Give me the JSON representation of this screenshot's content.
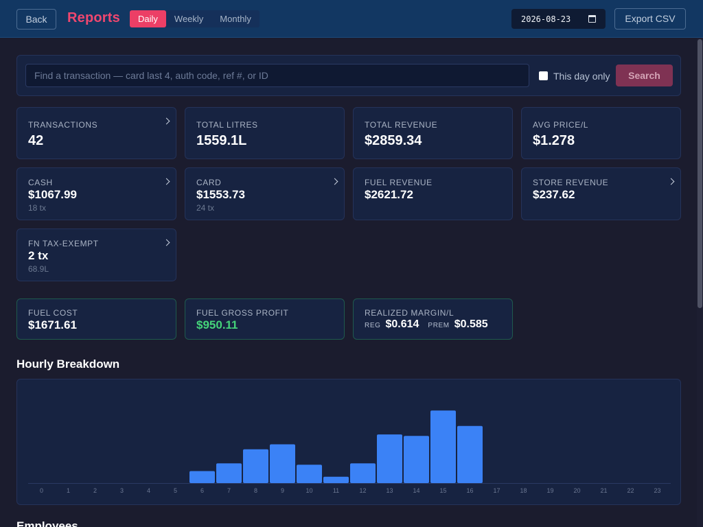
{
  "header": {
    "back_label": "Back",
    "title": "Reports",
    "tabs": [
      {
        "label": "Daily",
        "active": true
      },
      {
        "label": "Weekly",
        "active": false
      },
      {
        "label": "Monthly",
        "active": false
      }
    ],
    "date_value": "2026-08-23",
    "export_label": "Export CSV"
  },
  "search": {
    "placeholder": "Find a transaction — card last 4, auth code, ref #, or ID",
    "value": "",
    "checkbox_label": "This day only",
    "checkbox_checked": false,
    "button_label": "Search"
  },
  "stats": [
    {
      "label": "TRANSACTIONS",
      "value": "42"
    },
    {
      "label": "TOTAL LITRES",
      "value": "1559.1L"
    },
    {
      "label": "TOTAL REVENUE",
      "value": "$2859.34"
    },
    {
      "label": "AVG PRICE/L",
      "value": "$1.278"
    }
  ],
  "breakdown": [
    {
      "label": "CASH",
      "value": "$1067.99",
      "sub": "18 tx"
    },
    {
      "label": "CARD",
      "value": "$1553.73",
      "sub": "24 tx"
    },
    {
      "label": "FUEL REVENUE",
      "value": "$2621.72",
      "sub": ""
    },
    {
      "label": "STORE REVENUE",
      "value": "$237.62",
      "sub": ""
    },
    {
      "label": "FN TAX-EXEMPT",
      "value": "2 tx",
      "sub": "68.9L"
    }
  ],
  "profit": {
    "fuel_cost_label": "FUEL COST",
    "fuel_cost_value": "$1671.61",
    "gross_profit_label": "FUEL GROSS PROFIT",
    "gross_profit_value": "$950.11",
    "margin_label": "REALIZED MARGIN/L",
    "reg_label": "REG",
    "reg_value": "$0.614",
    "prem_label": "PREM",
    "prem_value": "$0.585"
  },
  "colors": {
    "accent": "#ec3f66",
    "bar": "#3b82f6",
    "profit": "#45d47a"
  },
  "hourly_title": "Hourly Breakdown",
  "employees_title": "Employees",
  "chart_data": {
    "type": "bar",
    "categories": [
      "0",
      "1",
      "2",
      "3",
      "4",
      "5",
      "6",
      "7",
      "8",
      "9",
      "10",
      "11",
      "12",
      "13",
      "14",
      "15",
      "16",
      "17",
      "18",
      "19",
      "20",
      "21",
      "22",
      "23"
    ],
    "values": [
      0,
      0,
      0,
      0,
      0,
      0,
      17,
      28,
      48,
      55,
      26,
      9,
      28,
      69,
      67,
      103,
      81,
      0,
      0,
      0,
      0,
      0,
      0,
      0
    ],
    "ylim": [
      0,
      110
    ],
    "grid": false
  }
}
